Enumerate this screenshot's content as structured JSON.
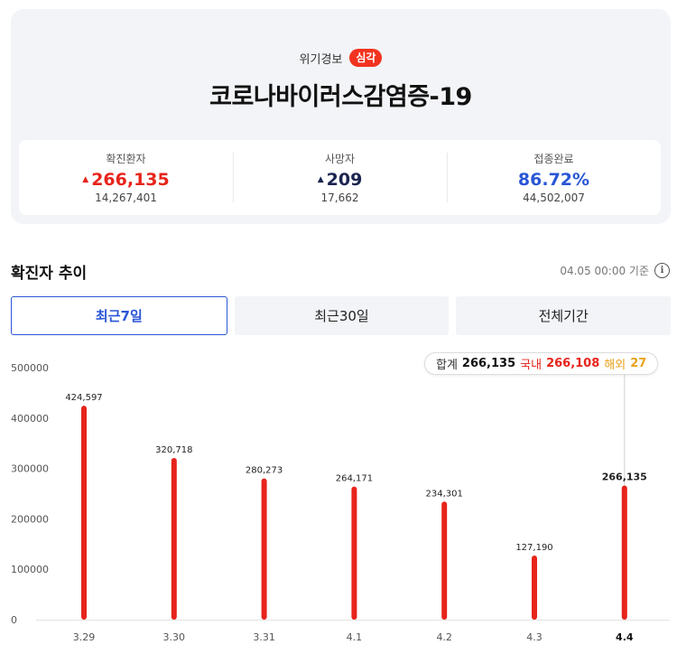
{
  "header": {
    "alert_label": "위기경보",
    "alert_level": "심각",
    "title": "코로나바이러스감염증-19"
  },
  "stats": [
    {
      "label": "확진환자",
      "value": "266,135",
      "arrow": "▲",
      "sub": "14,267,401"
    },
    {
      "label": "사망자",
      "value": "209",
      "arrow": "▲",
      "sub": "17,662"
    },
    {
      "label": "접종완료",
      "value": "86.72%",
      "arrow": "",
      "sub": "44,502,007"
    }
  ],
  "section": {
    "title": "확진자 추이",
    "reference_time": "04.05 00:00 기준"
  },
  "tabs": [
    {
      "label": "최근7일",
      "active": true
    },
    {
      "label": "최근30일",
      "active": false
    },
    {
      "label": "전체기간",
      "active": false
    }
  ],
  "tooltip": {
    "total_label": "합계",
    "total": "266,135",
    "domestic_label": "국내",
    "domestic": "266,108",
    "overseas_label": "해외",
    "overseas": "27"
  },
  "colors": {
    "accent_red": "#e7241b",
    "accent_blue": "#2a56d6",
    "overseas": "#e8a21b"
  },
  "chart_data": {
    "type": "bar",
    "categories": [
      "3.29",
      "3.30",
      "3.31",
      "4.1",
      "4.2",
      "4.3",
      "4.4"
    ],
    "values": [
      424597,
      320718,
      280273,
      264171,
      234301,
      127190,
      266135
    ],
    "labels": [
      "424,597",
      "320,718",
      "280,273",
      "264,171",
      "234,301",
      "127,190",
      "266,135"
    ],
    "y_ticks": [
      "0",
      "100000",
      "200000",
      "300000",
      "400000",
      "500000"
    ],
    "ylim": [
      0,
      500000
    ],
    "highlight_index": 6,
    "color": "#e7241b"
  }
}
